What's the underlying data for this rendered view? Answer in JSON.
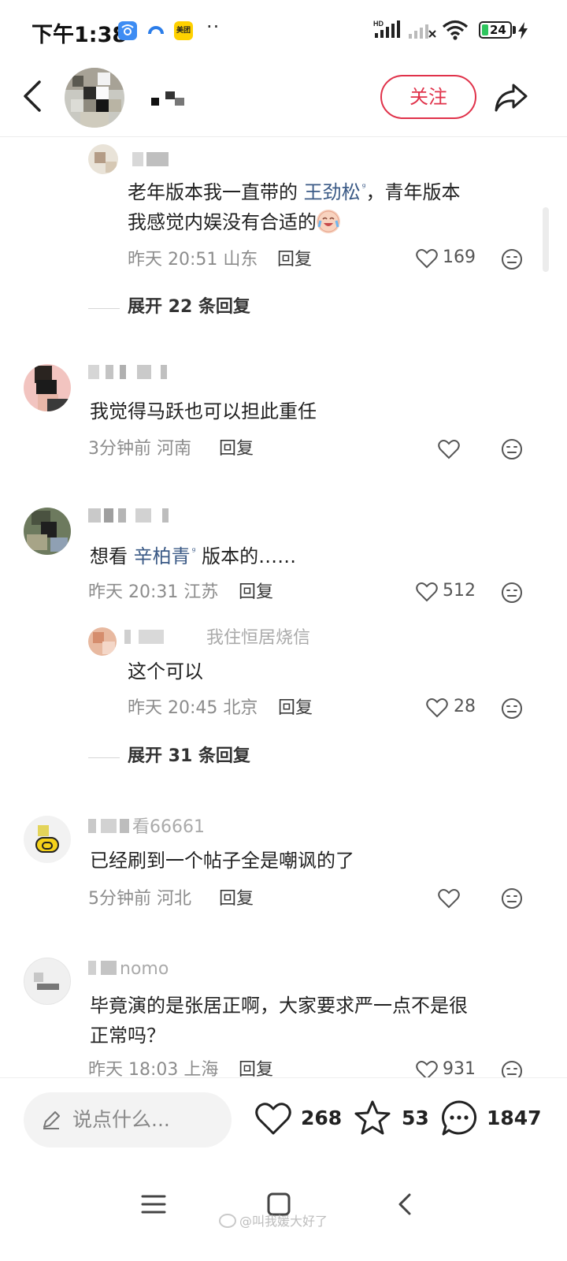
{
  "status_bar": {
    "time": "下午1:38",
    "app_icon_label": "美团",
    "more_dots": "··",
    "battery": "24"
  },
  "header": {
    "follow_label": "关注"
  },
  "comments": [
    {
      "text_lines": [
        "老年版本我一直带的 ",
        "王劲松",
        "，青年版本",
        "我感觉内娱没有合适的"
      ],
      "time_location": "昨天 20:51 山东",
      "reply_label": "回复",
      "likes": "169",
      "expand_label": "展开 22 条回复"
    },
    {
      "text": "我觉得马跃也可以担此重任",
      "time_location": "3分钟前 河南",
      "reply_label": "回复"
    },
    {
      "text_prefix": "想看 ",
      "topic": "辛柏青",
      "text_suffix": " 版本的……",
      "time_location": "昨天 20:31 江苏",
      "reply_label": "回复",
      "likes": "512",
      "sub_reply": {
        "name_partial": "我住恒居烧信",
        "text": "这个可以",
        "time_location": "昨天 20:45 北京",
        "reply_label": "回复",
        "likes": "28"
      },
      "expand_label": "展开 31 条回复"
    },
    {
      "name_partial": "看66661",
      "text": "已经刷到一个帖子全是嘲讽的了",
      "time_location": "5分钟前 河北",
      "reply_label": "回复"
    },
    {
      "name_partial": "nomo",
      "text_lines": [
        "毕竟演的是张居正啊，大家要求严一点不是很",
        "正常吗？"
      ],
      "time_location": "昨天 18:03 上海",
      "reply_label": "回复",
      "likes": "931"
    }
  ],
  "bottom_bar": {
    "input_placeholder": "说点什么...",
    "likes": "268",
    "stars": "53",
    "comments": "1847"
  },
  "watermark": "@叫我媛大好了",
  "colors": {
    "accent": "#e0324a",
    "topic": "#3b5a86",
    "meta": "#8c8c8c"
  }
}
